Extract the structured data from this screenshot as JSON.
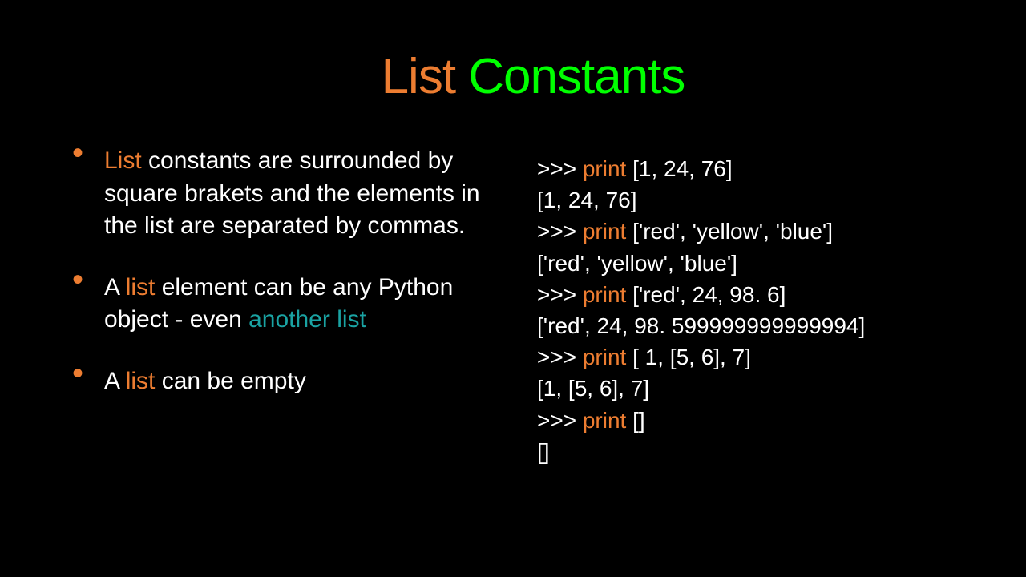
{
  "title": {
    "word1": "List",
    "word2": "Constants"
  },
  "bullets": [
    {
      "frag": [
        {
          "t": "List",
          "cls": "hl"
        },
        {
          "t": " constants are surrounded by square brakets and the elements in the list are separated by commas."
        }
      ]
    },
    {
      "frag": [
        {
          "t": "A "
        },
        {
          "t": "list",
          "cls": "hl"
        },
        {
          "t": " element can be any Python object - even "
        },
        {
          "t": "another list",
          "cls": "hl2"
        }
      ]
    },
    {
      "frag": [
        {
          "t": "A "
        },
        {
          "t": "list",
          "cls": "hl"
        },
        {
          "t": " can be empty"
        }
      ]
    }
  ],
  "code": [
    [
      {
        "t": ">>> "
      },
      {
        "t": "print ",
        "cls": "kw"
      },
      {
        "t": "[1, 24, 76]"
      }
    ],
    [
      {
        "t": "[1, 24, 76]"
      }
    ],
    [
      {
        "t": ">>> "
      },
      {
        "t": "print ",
        "cls": "kw"
      },
      {
        "t": "['red', 'yellow', 'blue']"
      }
    ],
    [
      {
        "t": "['red', 'yellow', 'blue']"
      }
    ],
    [
      {
        "t": ">>> "
      },
      {
        "t": "print ",
        "cls": "kw"
      },
      {
        "t": "['red', 24, 98. 6]"
      }
    ],
    [
      {
        "t": "['red', 24, 98. 599999999999994]"
      }
    ],
    [
      {
        "t": ">>> "
      },
      {
        "t": "print ",
        "cls": "kw"
      },
      {
        "t": "[ 1, [5, 6], 7]"
      }
    ],
    [
      {
        "t": "[1, [5, 6], 7]"
      }
    ],
    [
      {
        "t": ">>> "
      },
      {
        "t": "print ",
        "cls": "kw"
      },
      {
        "t": "[]"
      }
    ],
    [
      {
        "t": "[]"
      }
    ]
  ]
}
